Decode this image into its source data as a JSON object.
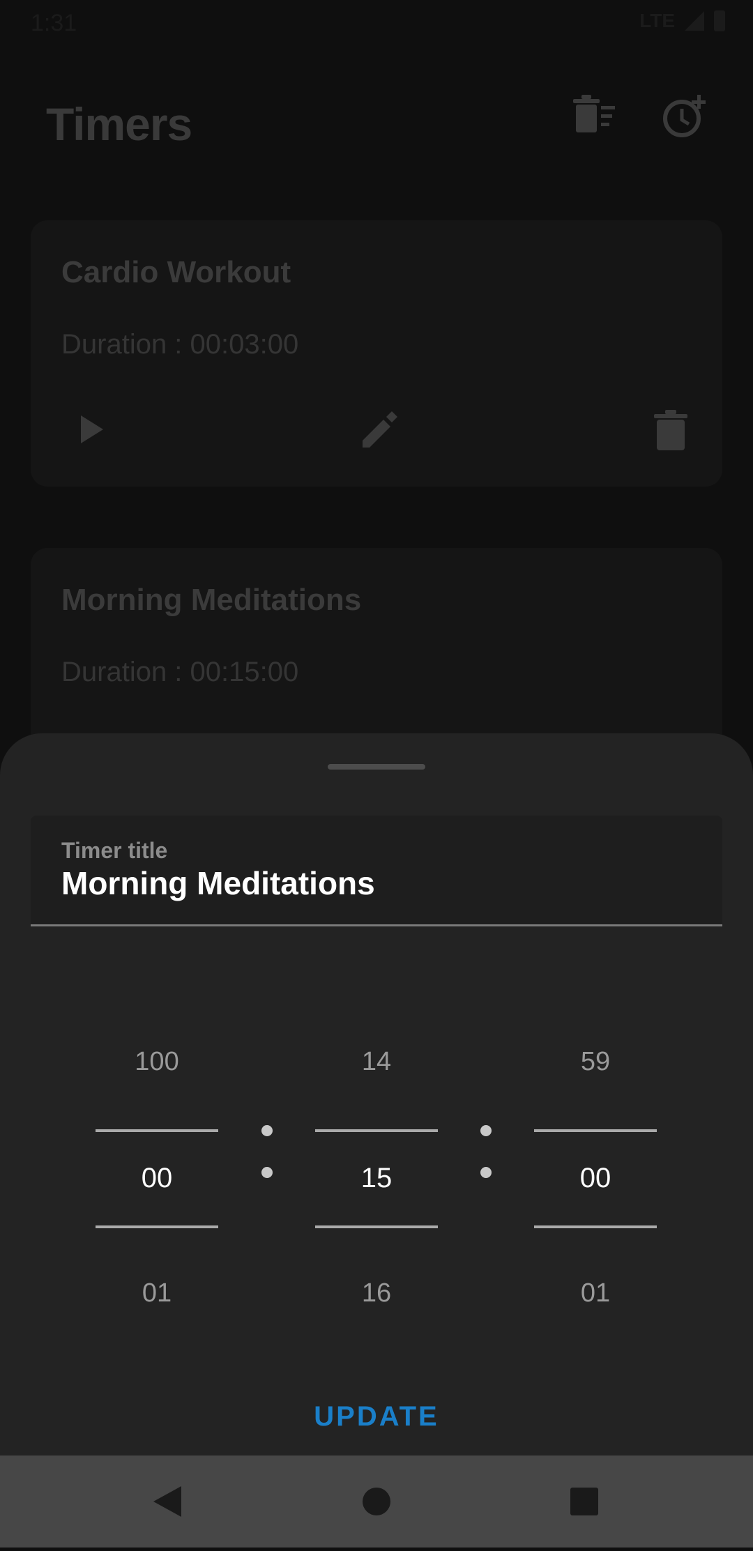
{
  "status_bar": {
    "time": "1:31",
    "network": "LTE"
  },
  "header": {
    "title": "Timers",
    "icons": [
      "delete-all-icon",
      "add-alarm-icon"
    ]
  },
  "timers": [
    {
      "title": "Cardio Workout",
      "duration": "Duration : 00:03:00"
    },
    {
      "title": "Morning Meditations",
      "duration": "Duration : 00:15:00"
    }
  ],
  "sheet": {
    "field_label": "Timer title",
    "field_value": "Morning Meditations",
    "pickers": [
      {
        "prev": "100",
        "current": "00",
        "next": "01"
      },
      {
        "prev": "14",
        "current": "15",
        "next": "16"
      },
      {
        "prev": "59",
        "current": "00",
        "next": "01"
      }
    ],
    "update_label": "UPDATE"
  },
  "colors": {
    "accent": "#1a7fc9",
    "sheet_bg": "#232323",
    "background": "#0f0f0f"
  },
  "nav": {
    "icons": [
      "back-icon",
      "home-icon",
      "recents-icon"
    ]
  }
}
